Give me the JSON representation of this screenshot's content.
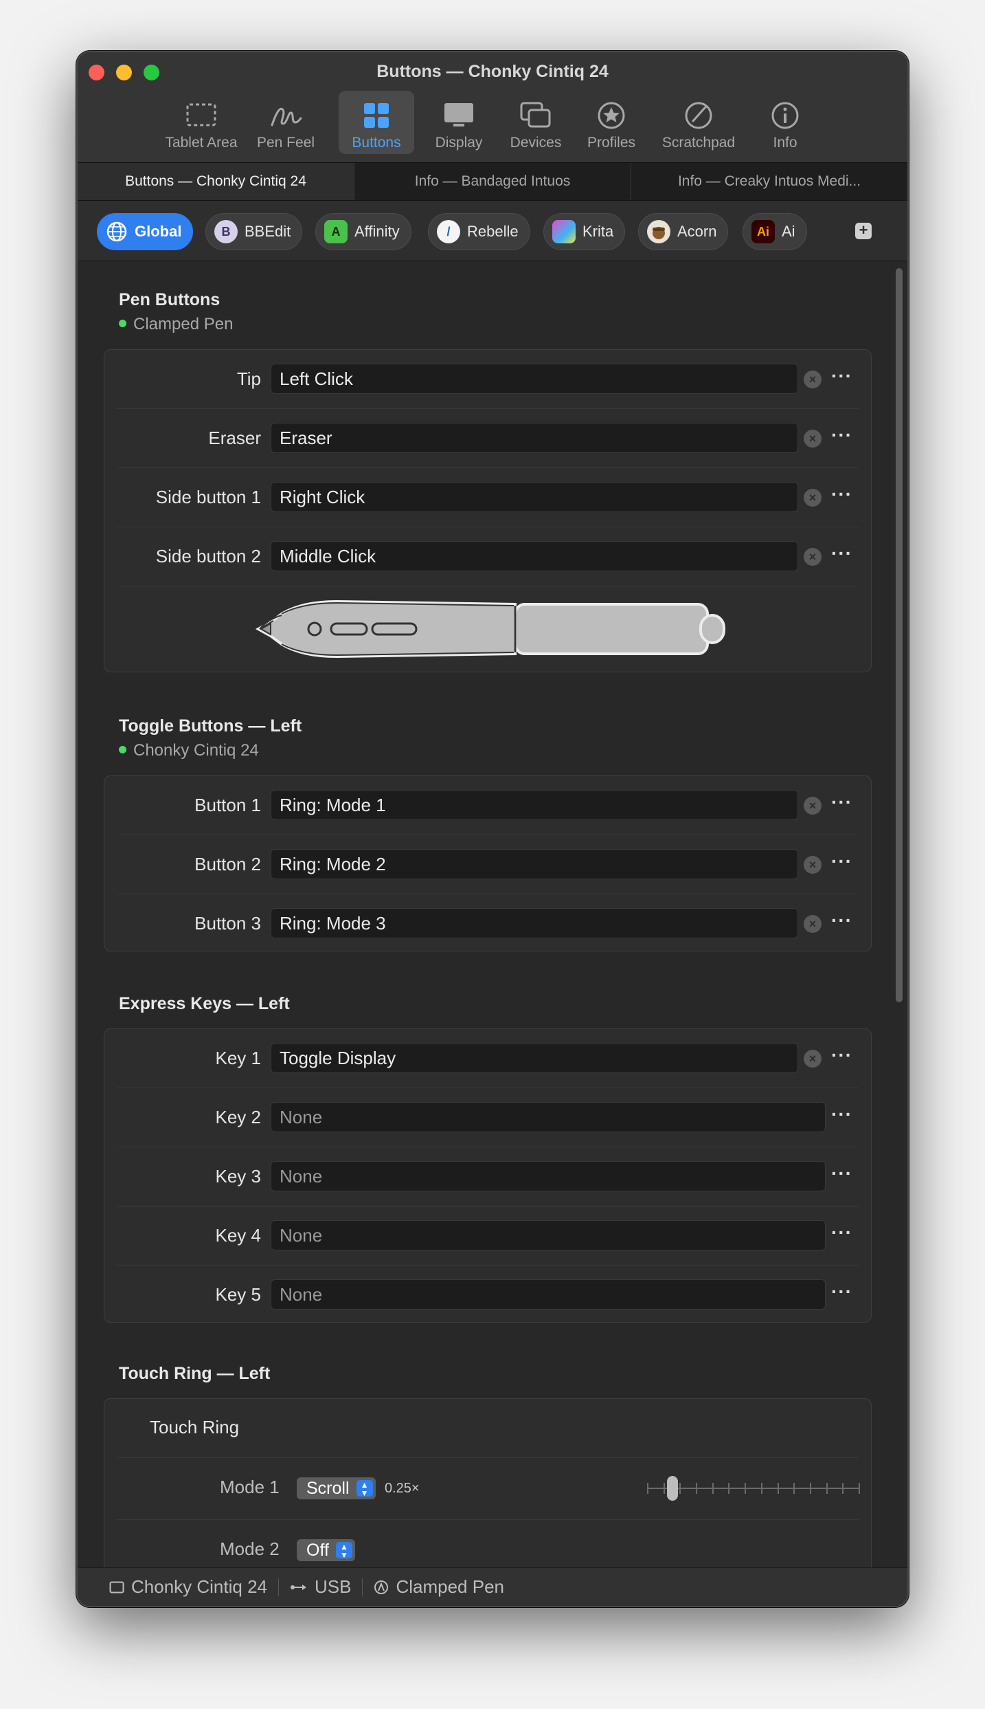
{
  "window": {
    "title": "Buttons — Chonky Cintiq 24",
    "accent": "#2f7ff0"
  },
  "toolbar": [
    {
      "label": "Tablet Area",
      "icon": "dashed-rect-icon"
    },
    {
      "label": "Pen Feel",
      "icon": "pen-stroke-icon"
    },
    {
      "label": "Buttons",
      "icon": "grid-icon",
      "active": true
    },
    {
      "label": "Display",
      "icon": "display-icon"
    },
    {
      "label": "Devices",
      "icon": "devices-icon"
    },
    {
      "label": "Profiles",
      "icon": "star-icon"
    },
    {
      "label": "Scratchpad",
      "icon": "scratchpad-icon"
    },
    {
      "label": "Info",
      "icon": "info-icon"
    }
  ],
  "tabs": [
    {
      "label": "Buttons — Chonky Cintiq 24",
      "active": true
    },
    {
      "label": "Info — Bandaged Intuos"
    },
    {
      "label": "Info — Creaky Intuos Medi..."
    }
  ],
  "apps": [
    {
      "label": "Global",
      "icon": "globe-icon",
      "active": true
    },
    {
      "label": "BBEdit",
      "icon": "bbedit-icon"
    },
    {
      "label": "Affinity",
      "icon": "affinity-icon"
    },
    {
      "label": "Rebelle",
      "icon": "rebelle-icon"
    },
    {
      "label": "Krita",
      "icon": "krita-icon"
    },
    {
      "label": "Acorn",
      "icon": "acorn-icon"
    },
    {
      "label": "Ai",
      "icon": "illustrator-icon"
    }
  ],
  "pen_buttons": {
    "title": "Pen Buttons",
    "device": "Clamped Pen",
    "rows": [
      {
        "label": "Tip",
        "value": "Left Click"
      },
      {
        "label": "Eraser",
        "value": "Eraser"
      },
      {
        "label": "Side button 1",
        "value": "Right Click"
      },
      {
        "label": "Side button 2",
        "value": "Middle Click"
      }
    ]
  },
  "toggle_buttons": {
    "title": "Toggle Buttons — Left",
    "device": "Chonky Cintiq 24",
    "rows": [
      {
        "label": "Button 1",
        "value": "Ring: Mode 1"
      },
      {
        "label": "Button 2",
        "value": "Ring: Mode 2"
      },
      {
        "label": "Button 3",
        "value": "Ring: Mode 3"
      }
    ]
  },
  "express_keys": {
    "title": "Express Keys — Left",
    "rows": [
      {
        "label": "Key 1",
        "value": "Toggle Display"
      },
      {
        "label": "Key 2",
        "value": "None"
      },
      {
        "label": "Key 3",
        "value": "None"
      },
      {
        "label": "Key 4",
        "value": "None"
      },
      {
        "label": "Key 5",
        "value": "None"
      }
    ]
  },
  "touch_ring": {
    "title": "Touch Ring — Left",
    "group_label": "Touch Ring",
    "mode1": {
      "label": "Mode 1",
      "value": "Scroll",
      "speed": "0.25×",
      "slider_fraction": 0.1
    },
    "mode2": {
      "label": "Mode 2",
      "value": "Off"
    }
  },
  "status": {
    "device": "Chonky Cintiq 24",
    "connection": "USB",
    "pen": "Clamped Pen"
  }
}
